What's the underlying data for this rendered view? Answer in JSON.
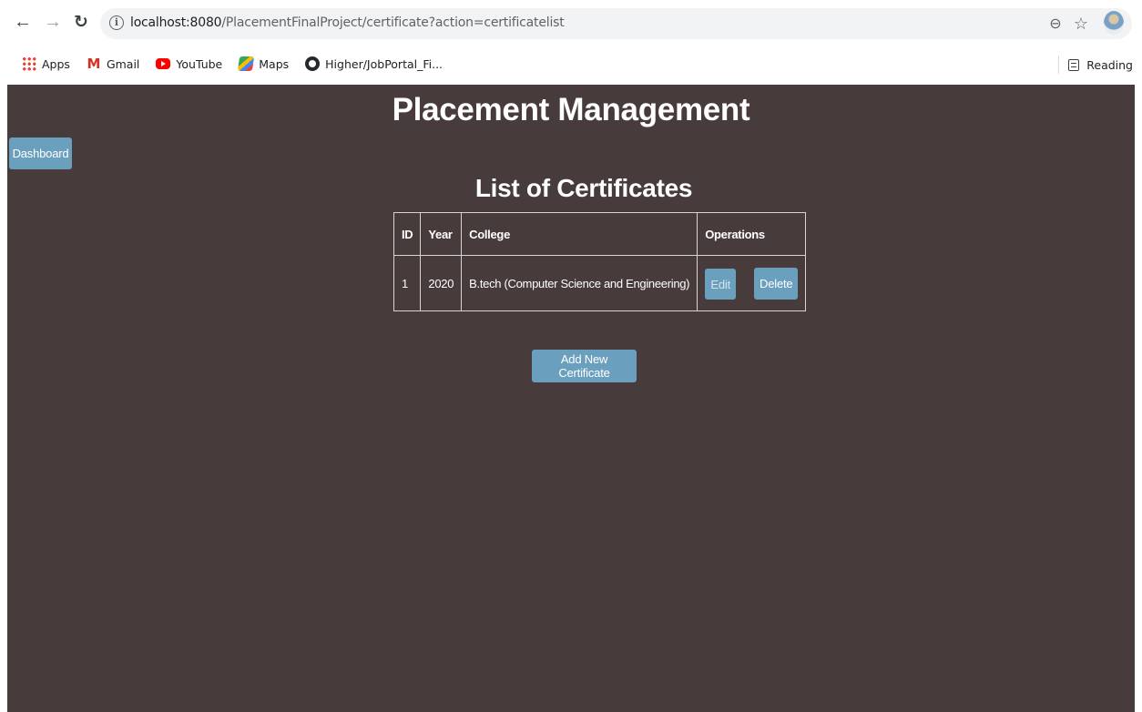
{
  "browser": {
    "url_host": "localhost:8080",
    "url_path": "/PlacementFinalProject/certificate?action=certificatelist",
    "bookmarks": [
      {
        "label": "Apps",
        "icon": "apps-grid-icon"
      },
      {
        "label": "Gmail",
        "icon": "gmail-icon"
      },
      {
        "label": "YouTube",
        "icon": "youtube-icon"
      },
      {
        "label": "Maps",
        "icon": "maps-icon"
      },
      {
        "label": "Higher/JobPortal_Fi...",
        "icon": "github-icon"
      }
    ],
    "reading_list": "Reading"
  },
  "page": {
    "title": "Placement Management",
    "dashboard_label": "Dashboard",
    "list_title": "List of Certificates",
    "table": {
      "headers": [
        "ID",
        "Year",
        "College",
        "Operations"
      ],
      "rows": [
        {
          "id": "1",
          "year": "2020",
          "college": "B.tech (Computer Science and Engineering)",
          "edit_label": "Edit",
          "delete_label": "Delete"
        }
      ]
    },
    "add_label": "Add New Certificate"
  },
  "colors": {
    "page_background": "#473b3b",
    "button": "#6b9fbe"
  }
}
